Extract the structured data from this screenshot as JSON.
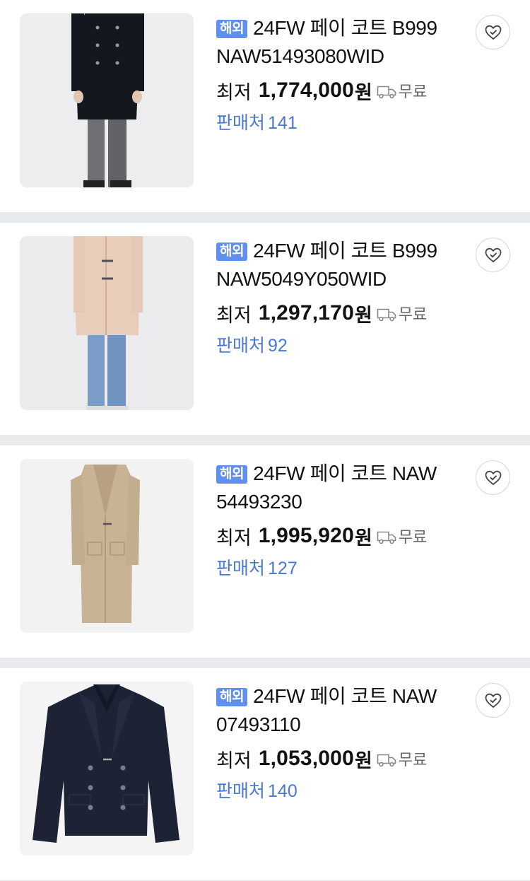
{
  "products": [
    {
      "badge": "해외",
      "title": "24FW 페이 코트 B999 NAW51493080WID",
      "price_prefix": "최저",
      "price": "1,774,000",
      "currency": "원",
      "shipping": "무료",
      "sellers_label": "판매처",
      "sellers_count": "141",
      "image_icon": "black-long-coat-photo"
    },
    {
      "badge": "해외",
      "title": "24FW 페이 코트 B999 NAW5049Y050WID",
      "price_prefix": "최저",
      "price": "1,297,170",
      "currency": "원",
      "shipping": "무료",
      "sellers_label": "판매처",
      "sellers_count": "92",
      "image_icon": "beige-toggle-coat-photo"
    },
    {
      "badge": "해외",
      "title": "24FW 페이 코트 NAW 54493230",
      "price_prefix": "최저",
      "price": "1,995,920",
      "currency": "원",
      "shipping": "무료",
      "sellers_label": "판매처",
      "sellers_count": "127",
      "image_icon": "camel-long-coat-photo"
    },
    {
      "badge": "해외",
      "title": "24FW 페이 코트 NAW 07493110",
      "price_prefix": "최저",
      "price": "1,053,000",
      "currency": "원",
      "shipping": "무료",
      "sellers_label": "판매처",
      "sellers_count": "140",
      "image_icon": "navy-pea-coat-photo"
    }
  ],
  "colors": {
    "badge": "#5f8ff0",
    "sellers": "#4a78d6",
    "divider": "#e9eaee",
    "shipping_text": "#666666"
  }
}
